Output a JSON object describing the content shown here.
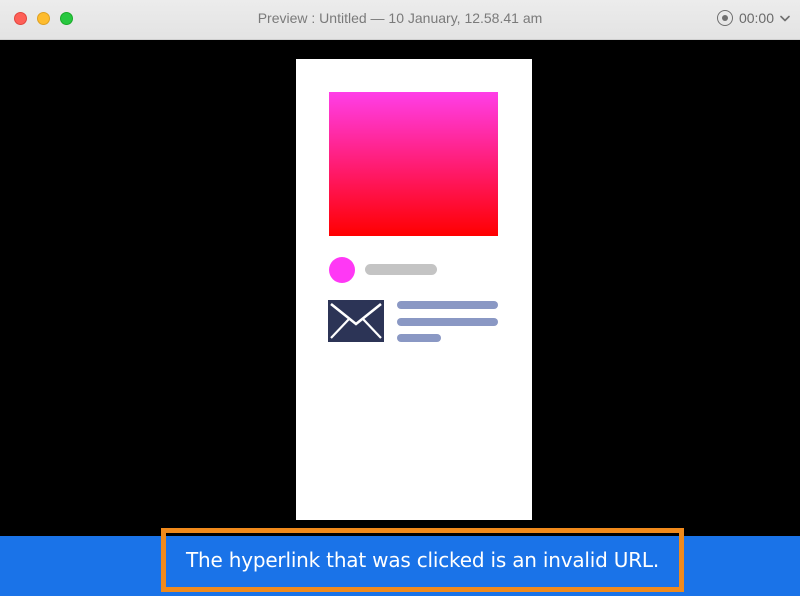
{
  "window": {
    "title": "Preview : Untitled — 10 January, 12.58.41 am",
    "recording_time": "00:00",
    "controls": [
      "close",
      "minimize",
      "zoom"
    ],
    "icons": {
      "record": "record-icon",
      "menu": "chevron-down-icon",
      "mail": "envelope-icon"
    }
  },
  "notification": {
    "message": "The hyperlink that was clicked is an invalid URL."
  },
  "colors": {
    "hero_top": "#ff3ee8",
    "hero_bottom": "#ff0000",
    "avatar": "#ff38f5",
    "notice_background": "#1a73e8",
    "highlight_border": "#f08a1c",
    "envelope": "#2c3456",
    "text_lines": "#8a98c4"
  }
}
